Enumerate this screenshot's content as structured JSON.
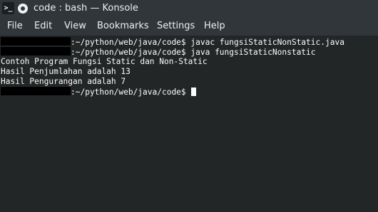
{
  "window": {
    "app_icon_glyph": ">_",
    "title": "code : bash — Konsole"
  },
  "menu": [
    "File",
    "Edit",
    "View",
    "Bookmarks",
    "Settings",
    "Help"
  ],
  "terminal": {
    "lines": [
      {
        "prompt": ":~/python/web/java/code$ ",
        "command": "javac fungsiStaticNonStatic.java"
      },
      {
        "prompt": ":~/python/web/java/code$ ",
        "command": "java fungsiStaticNonstatic"
      },
      {
        "output": "Contoh Program Fungsi Static dan Non-Static"
      },
      {
        "output": "Hasil Penjumlahan adalah 13"
      },
      {
        "output": "Hasil Pengurangan adalah 7"
      },
      {
        "prompt": ":~/python/web/java/code$ ",
        "command": ""
      }
    ]
  },
  "colors": {
    "chrome": "#31363b",
    "terminal_bg": "#232627",
    "terminal_fg": "#fcfcfc",
    "redaction": "#000000"
  }
}
